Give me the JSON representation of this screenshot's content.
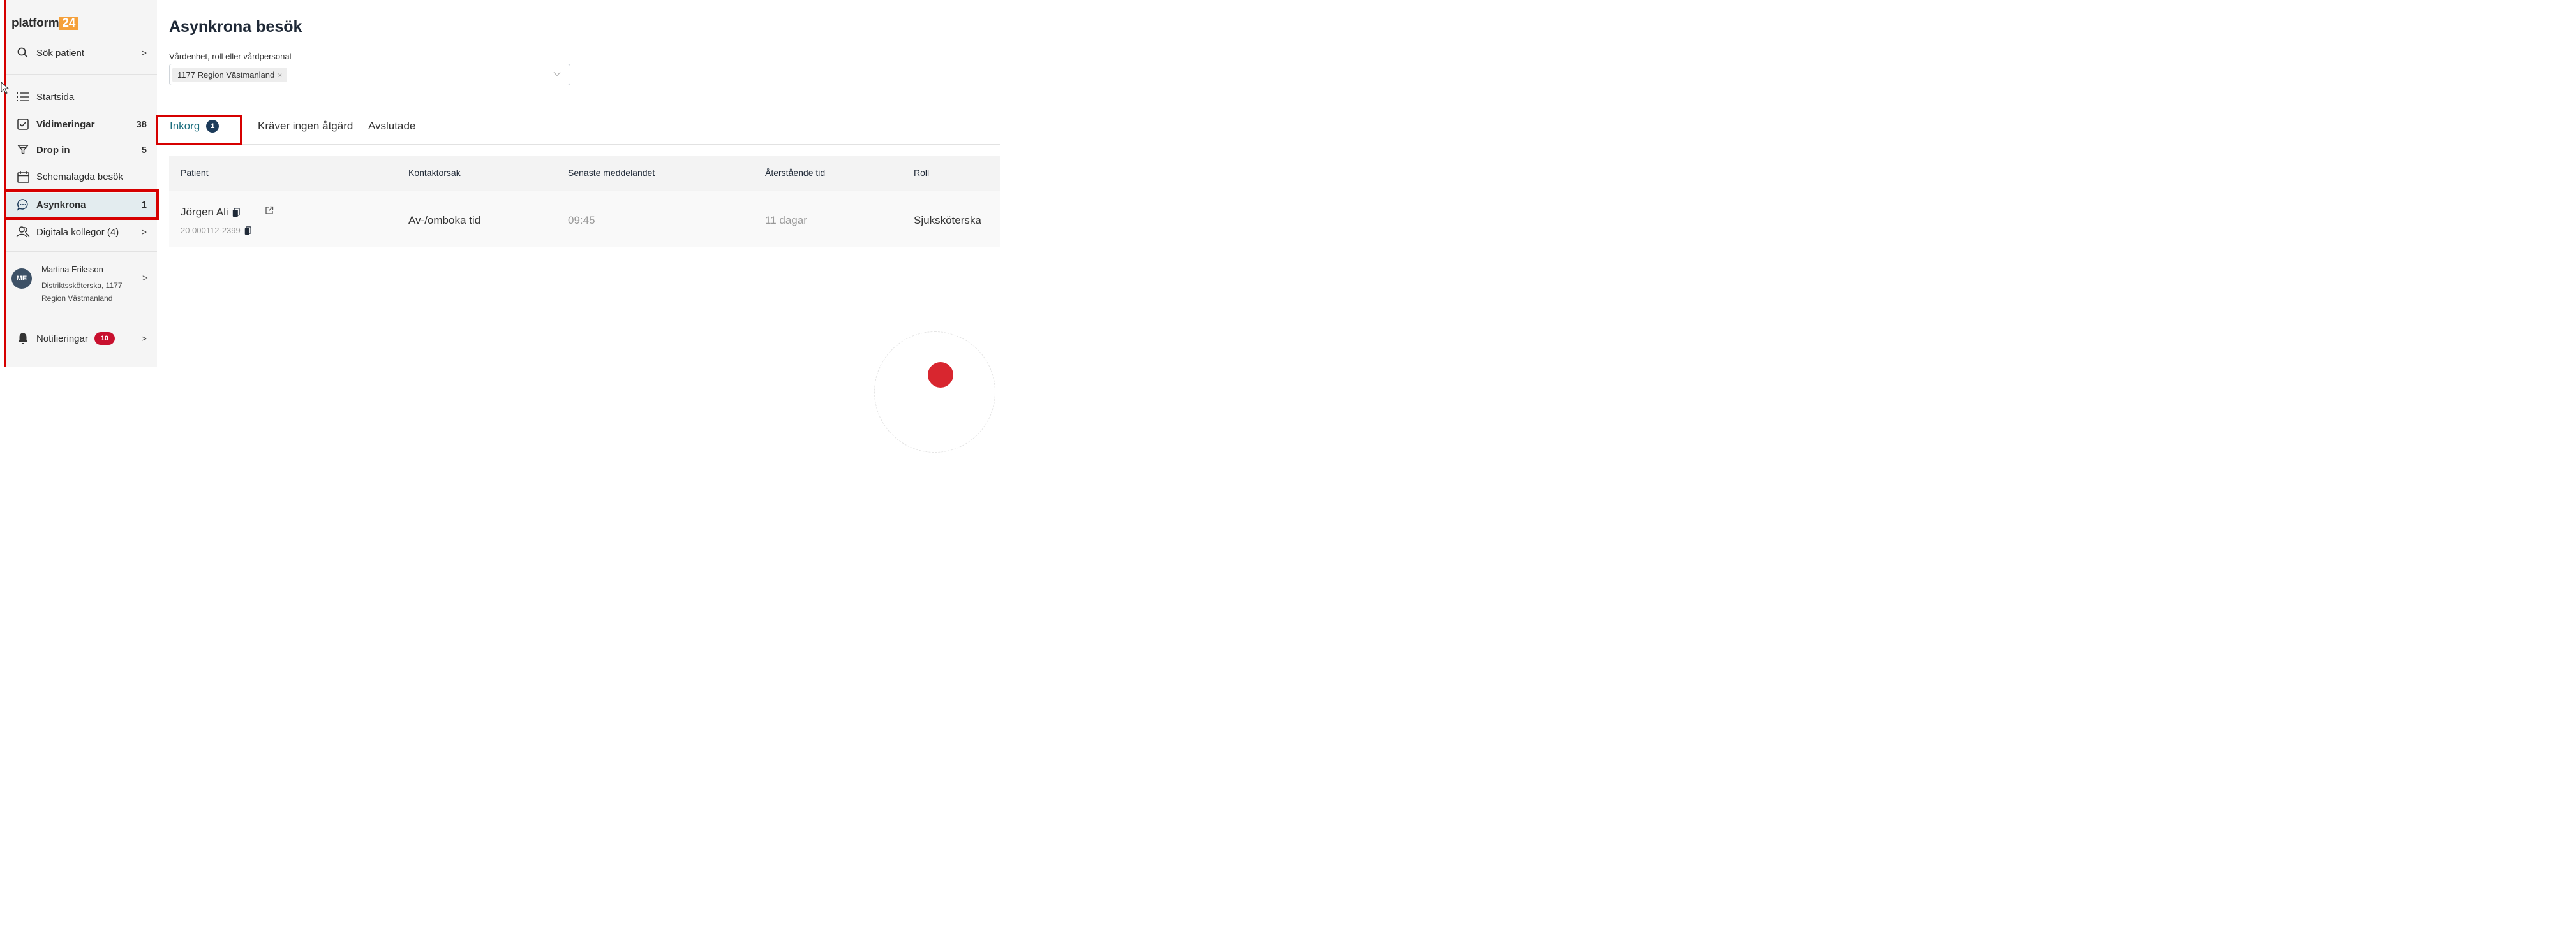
{
  "brand": {
    "name": "platform",
    "number": "24",
    "accent": "#f5a03a"
  },
  "sidebar": {
    "search": {
      "label": "Sök patient",
      "icon": "search-icon"
    },
    "items": [
      {
        "label": "Startsida",
        "icon": "list-icon",
        "count": ""
      },
      {
        "label": "Vidimeringar",
        "icon": "checkbox-icon",
        "count": "38"
      },
      {
        "label": "Drop in",
        "icon": "funnel-icon",
        "count": "5"
      },
      {
        "label": "Schemalagda besök",
        "icon": "calendar-icon",
        "count": ""
      },
      {
        "label": "Asynkrona",
        "icon": "chat-icon",
        "count": "1"
      },
      {
        "label": "Digitala kollegor (4)",
        "icon": "people-icon",
        "count": ""
      }
    ],
    "user": {
      "initials": "ME",
      "name": "Martina Eriksson",
      "role": "Distriktssköterska, 1177 Region Västmanland"
    },
    "notifications": {
      "label": "Notifieringar",
      "count": "10",
      "icon": "bell-icon"
    }
  },
  "main": {
    "title": "Asynkrona besök",
    "filter": {
      "label": "Vårdenhet, roll eller vårdpersonal",
      "chip": "1177 Region Västmanland",
      "chip_remove": "×"
    },
    "tabs": [
      {
        "label": "Inkorg",
        "badge": "1"
      },
      {
        "label": "Kräver ingen åtgärd"
      },
      {
        "label": "Avslutade"
      }
    ],
    "table": {
      "columns": [
        "Patient",
        "Kontaktorsak",
        "Senaste meddelandet",
        "Återstående tid",
        "Roll"
      ],
      "rows": [
        {
          "patient": "Jörgen Ali",
          "personnummer": "20 000112-2399",
          "reason": "Av-/omboka tid",
          "last_message": "09:45",
          "remaining": "11 dagar",
          "role": "Sjuksköterska"
        }
      ]
    }
  },
  "colors": {
    "highlight": "#d60000",
    "active_tab": "#1c6e7e",
    "active_bg": "#e3ecef",
    "badge_red": "#c8102e"
  }
}
